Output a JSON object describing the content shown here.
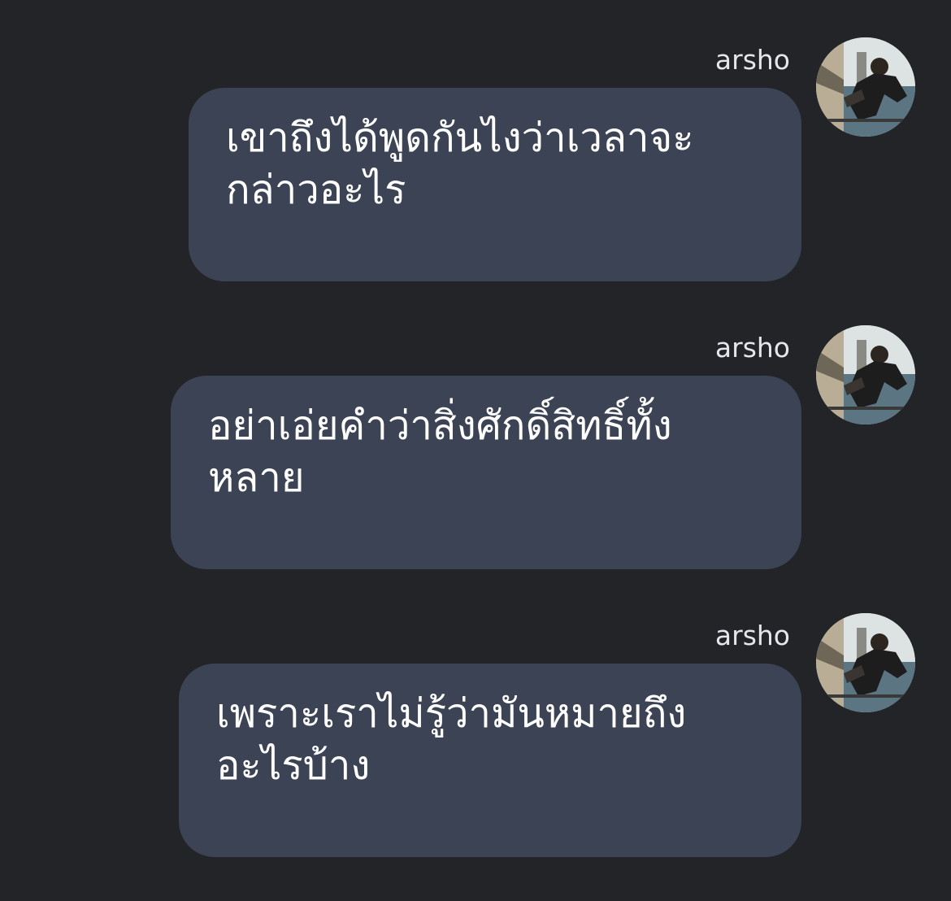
{
  "messages": [
    {
      "sender": "arsho",
      "avatar_icon": "user-photo-avatar",
      "lines": [
        "เขาถึงได้พูดกันไงว่าเวลาจะ",
        "กล่าวอะไร"
      ]
    },
    {
      "sender": "arsho",
      "avatar_icon": "user-photo-avatar",
      "lines": [
        "อย่าเอ่ยคำว่าสิ่งศักดิ์สิทธิ์ทั้ง",
        "หลาย"
      ]
    },
    {
      "sender": "arsho",
      "avatar_icon": "user-photo-avatar",
      "lines": [
        "เพราะเราไม่รู้ว่ามันหมายถึง",
        "อะไรบ้าง"
      ]
    }
  ],
  "colors": {
    "background": "#232428",
    "bubble": "#3c4354",
    "text": "#ffffff",
    "sender_text": "#e4e6eb"
  }
}
